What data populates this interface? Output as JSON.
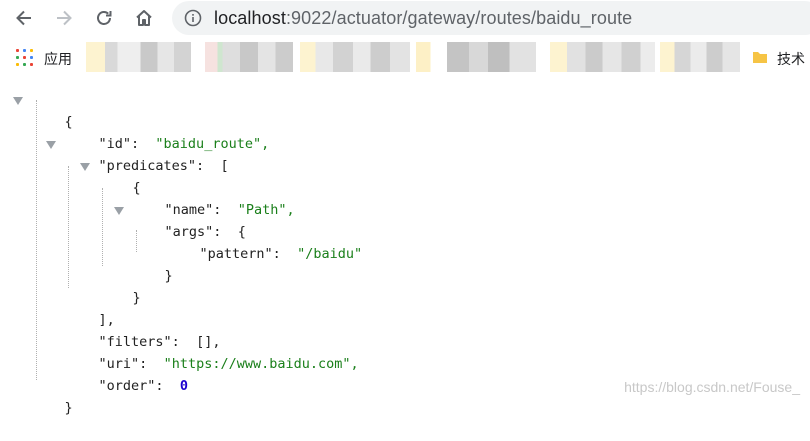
{
  "browser": {
    "url_host": "localhost",
    "url_rest": ":9022/actuator/gateway/routes/baidu_route",
    "bookmarks": {
      "apps_label": "应用",
      "right_label": "技术"
    }
  },
  "json_view": {
    "open_brace": "{",
    "id_key": "\"id\":",
    "id_value": "\"baidu_route\",",
    "predicates_key": "\"predicates\":",
    "open_bracket": "[",
    "pred_open_brace": "{",
    "name_key": "\"name\":",
    "name_value": "\"Path\",",
    "args_key": "\"args\":",
    "args_open_brace": "{",
    "pattern_key": "\"pattern\":",
    "pattern_value": "\"/baidu\"",
    "args_close_brace": "}",
    "pred_close_brace": "}",
    "close_bracket": "],",
    "filters_key": "\"filters\":",
    "filters_value": "[],",
    "uri_key": "\"uri\":",
    "uri_value": "\"https://www.baidu.com\",",
    "order_key": "\"order\":",
    "order_value": "0",
    "close_brace": "}"
  },
  "watermark": "https://blog.csdn.net/Fouse_",
  "colors": {
    "key_text": "#222222",
    "string_value": "#1a7f1a",
    "number_value": "#1c00cf",
    "toggle_triangle": "#9aa0a6"
  }
}
